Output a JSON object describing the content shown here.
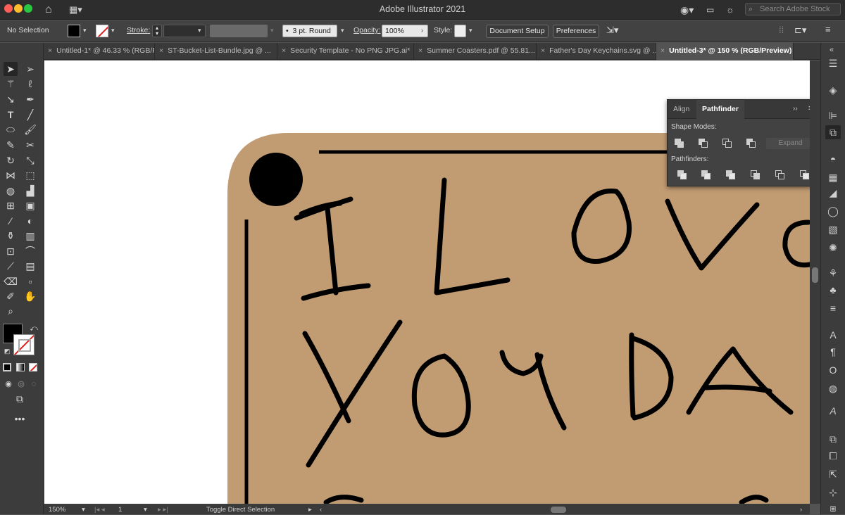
{
  "app": {
    "title": "Adobe Illustrator 2021",
    "search_placeholder": "Search Adobe Stock"
  },
  "control_bar": {
    "selection": "No Selection",
    "stroke_label": "Stroke:",
    "brush": "3 pt. Round",
    "opacity_label": "Opacity:",
    "opacity_value": "100%",
    "style_label": "Style:",
    "document_setup": "Document Setup",
    "preferences": "Preferences"
  },
  "tabs": [
    {
      "label": "Untitled-1* @ 46.33 % (RGB/P..."
    },
    {
      "label": "ST-Bucket-List-Bundle.jpg @ ..."
    },
    {
      "label": "Security Template - No PNG JPG.ai*"
    },
    {
      "label": "Summer Coasters.pdf @ 55.81..."
    },
    {
      "label": "Father's Day Keychains.svg @ ..."
    },
    {
      "label": "Untitled-3* @ 150 % (RGB/Preview)",
      "active": true
    }
  ],
  "pathfinder_panel": {
    "tabs": [
      "Align",
      "Pathfinder"
    ],
    "active_tab": "Pathfinder",
    "shape_modes_label": "Shape Modes:",
    "pathfinders_label": "Pathfinders:",
    "expand_label": "Expand"
  },
  "status_bar": {
    "zoom": "150%",
    "artboard": "1",
    "tool_hint": "Toggle Direct Selection"
  },
  "artwork": {
    "board_color": "#c19c73",
    "ink_color": "#000000"
  },
  "colors": {
    "ui_dark": "#535353",
    "panel": "#424242",
    "accent_red": "#e02020"
  }
}
